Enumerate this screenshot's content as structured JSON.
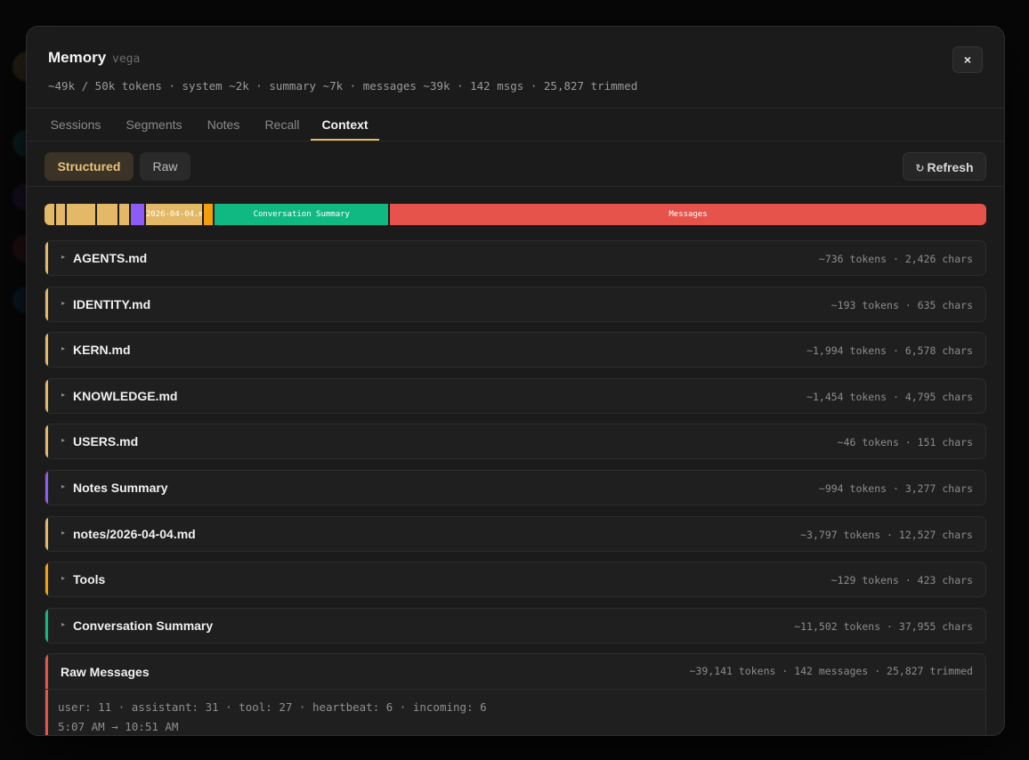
{
  "modal": {
    "title": "Memory",
    "agent": "vega",
    "stats": "~49k / 50k tokens · system ~2k · summary ~7k · messages ~39k · 142 msgs · 25,827 trimmed",
    "close_label": "×"
  },
  "tabs": [
    {
      "label": "Sessions",
      "active": false
    },
    {
      "label": "Segments",
      "active": false
    },
    {
      "label": "Notes",
      "active": false
    },
    {
      "label": "Recall",
      "active": false
    },
    {
      "label": "Context",
      "active": true
    }
  ],
  "toolbar": {
    "structured_label": "Structured",
    "raw_label": "Raw",
    "refresh_icon": "refresh-icon",
    "refresh_label": "Refresh"
  },
  "colors": {
    "file": "#e3b866",
    "notes_summary": "#8b5cf6",
    "tools": "#f59e0b",
    "conversation": "#10b981",
    "messages": "#e5534b",
    "accent": "#e3b866"
  },
  "token_bar": [
    {
      "label": "",
      "tokens": 736,
      "color": "#e3b866"
    },
    {
      "label": "",
      "tokens": 193,
      "color": "#e3b866"
    },
    {
      "label": "",
      "tokens": 1994,
      "color": "#e3b866"
    },
    {
      "label": "",
      "tokens": 1454,
      "color": "#e3b866"
    },
    {
      "label": "",
      "tokens": 46,
      "color": "#e3b866"
    },
    {
      "label": "",
      "tokens": 994,
      "color": "#8b5cf6"
    },
    {
      "label": "2026-04-04.md",
      "tokens": 3797,
      "color": "#e3b866"
    },
    {
      "label": "",
      "tokens": 129,
      "color": "#f59e0b"
    },
    {
      "label": "Conversation Summary",
      "tokens": 11502,
      "color": "#10b981"
    },
    {
      "label": "Messages",
      "tokens": 39141,
      "color": "#e5534b"
    }
  ],
  "sections": [
    {
      "name": "AGENTS.md",
      "meta": "~736 tokens · 2,426 chars",
      "color": "#e3b866"
    },
    {
      "name": "IDENTITY.md",
      "meta": "~193 tokens · 635 chars",
      "color": "#e3b866"
    },
    {
      "name": "KERN.md",
      "meta": "~1,994 tokens · 6,578 chars",
      "color": "#e3b866"
    },
    {
      "name": "KNOWLEDGE.md",
      "meta": "~1,454 tokens · 4,795 chars",
      "color": "#e3b866"
    },
    {
      "name": "USERS.md",
      "meta": "~46 tokens · 151 chars",
      "color": "#e3b866"
    },
    {
      "name": "Notes Summary",
      "meta": "~994 tokens · 3,277 chars",
      "color": "#8b5cf6"
    },
    {
      "name": "notes/2026-04-04.md",
      "meta": "~3,797 tokens · 12,527 chars",
      "color": "#e3b866"
    },
    {
      "name": "Tools",
      "meta": "~129 tokens · 423 chars",
      "color": "#f59e0b"
    },
    {
      "name": "Conversation Summary",
      "meta": "~11,502 tokens · 37,955 chars",
      "color": "#10b981"
    }
  ],
  "raw_messages": {
    "title": "Raw Messages",
    "meta": "~39,141 tokens · 142 messages · 25,827 trimmed",
    "breakdown": "user: 11 · assistant: 31 · tool: 27 · heartbeat: 6 · incoming: 6",
    "time_range": "5:07 AM → 10:51 AM"
  }
}
